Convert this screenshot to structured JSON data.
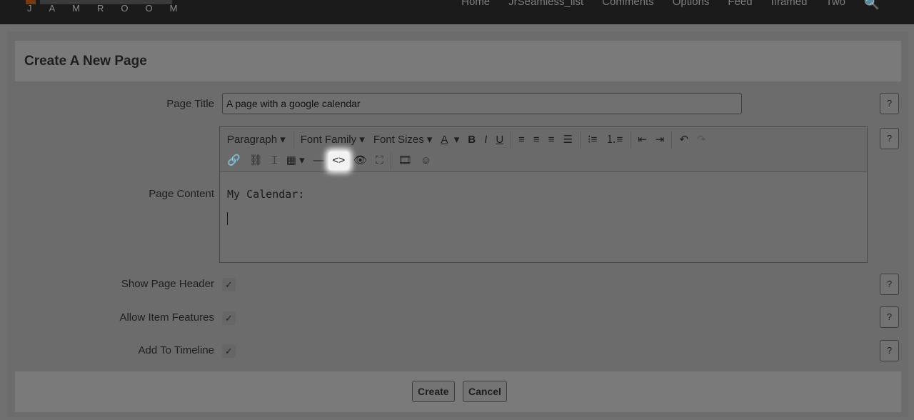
{
  "site": {
    "logo_text": "JAMROOM",
    "nav": [
      "Home",
      "JrSeamless_list",
      "Comments",
      "Options",
      "Feed",
      "Iframed",
      "Two"
    ]
  },
  "form": {
    "title": "Create A New Page",
    "page_title_label": "Page Title",
    "page_title_value": "A page with a google calendar",
    "page_content_label": "Page Content",
    "toolbar": {
      "paragraph": "Paragraph",
      "font_family": "Font Family",
      "font_sizes": "Font Sizes"
    },
    "content_text": "My Calendar:",
    "show_header_label": "Show Page Header",
    "allow_features_label": "Allow Item Features",
    "timeline_label": "Add To Timeline",
    "help": "?",
    "check": "✓",
    "create": "Create",
    "cancel": "Cancel"
  }
}
